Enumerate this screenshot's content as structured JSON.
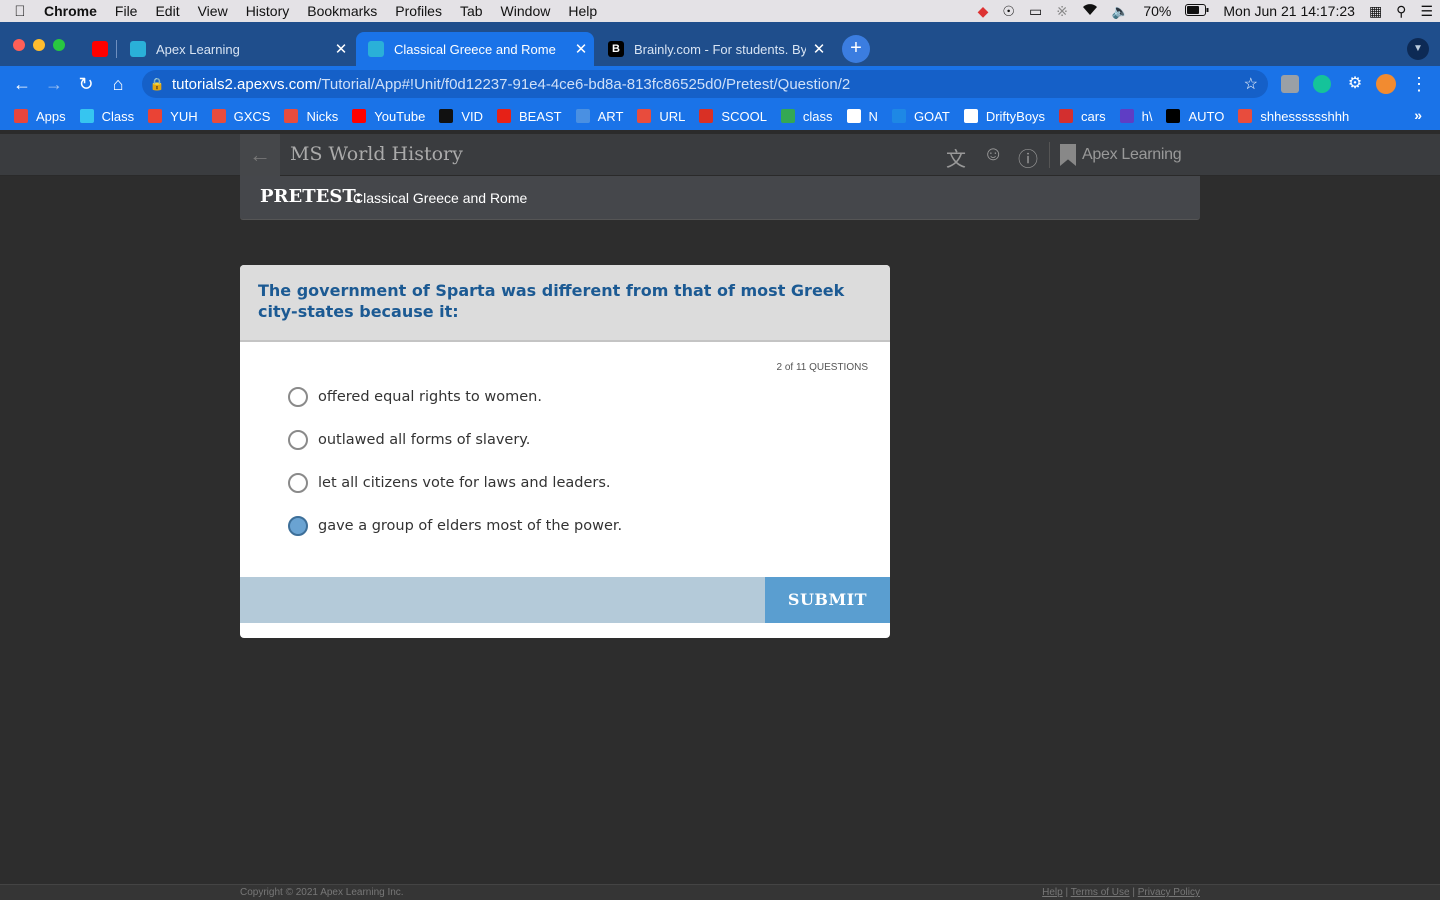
{
  "menubar": {
    "app": "Chrome",
    "items": [
      "File",
      "Edit",
      "View",
      "History",
      "Bookmarks",
      "Profiles",
      "Tab",
      "Window",
      "Help"
    ],
    "battery": "70%",
    "clock": "Mon Jun 21  14:17:23"
  },
  "tabs": [
    {
      "title": "",
      "favicon": "youtube-icon"
    },
    {
      "title": "Apex Learning",
      "favicon": "apex-icon"
    },
    {
      "title": "Classical Greece and Rome",
      "favicon": "apex-icon",
      "active": true
    },
    {
      "title": "Brainly.com - For students. By",
      "favicon": "brainly-icon"
    }
  ],
  "address": {
    "host": "tutorials2.apexvs.com",
    "path": "/Tutorial/App#!Unit/f0d12237-91e4-4ce6-bd8a-813fc86525d0/Pretest/Question/2"
  },
  "bookmarks": [
    {
      "label": "Apps",
      "color": "#e8453c"
    },
    {
      "label": "Class",
      "color": "#36c5f0"
    },
    {
      "label": "YUH",
      "color": "#ea4335"
    },
    {
      "label": "GXCS",
      "color": "#e84c3d"
    },
    {
      "label": "Nicks",
      "color": "#e84c3d"
    },
    {
      "label": "YouTube",
      "color": "#ff0000"
    },
    {
      "label": "VID",
      "color": "#111111"
    },
    {
      "label": "BEAST",
      "color": "#e62117"
    },
    {
      "label": "ART",
      "color": "#4a90e2"
    },
    {
      "label": "URL",
      "color": "#e84c3d"
    },
    {
      "label": "SCOOL",
      "color": "#d93025"
    },
    {
      "label": "class",
      "color": "#34a853"
    },
    {
      "label": "N",
      "color": "#ffffff"
    },
    {
      "label": "GOAT",
      "color": "#1e88e5"
    },
    {
      "label": "DriftyBoys",
      "color": "#ffffff"
    },
    {
      "label": "cars",
      "color": "#d32f2f"
    },
    {
      "label": "h\\",
      "color": "#5f3dc4"
    },
    {
      "label": "AUTO",
      "color": "#000000"
    },
    {
      "label": "shhesssssshhh",
      "color": "#e84c3d"
    }
  ],
  "app": {
    "course": "MS World History",
    "brand": "Apex Learning"
  },
  "pretest": {
    "label": "PRETEST:",
    "title": "Classical Greece and Rome"
  },
  "question": {
    "text": "The government of Sparta was different from that of most Greek city-states because it:",
    "counter": "2 of 11 QUESTIONS",
    "options": [
      {
        "text": "offered equal rights to women.",
        "selected": false
      },
      {
        "text": "outlawed all forms of slavery.",
        "selected": false
      },
      {
        "text": "let all citizens vote for laws and leaders.",
        "selected": false
      },
      {
        "text": "gave a group of elders most of the power.",
        "selected": true
      }
    ],
    "submit": "SUBMIT"
  },
  "footer": {
    "copyright": "Copyright © 2021 Apex Learning Inc.",
    "help": "Help",
    "terms": "Terms of Use",
    "privacy": "Privacy Policy"
  }
}
